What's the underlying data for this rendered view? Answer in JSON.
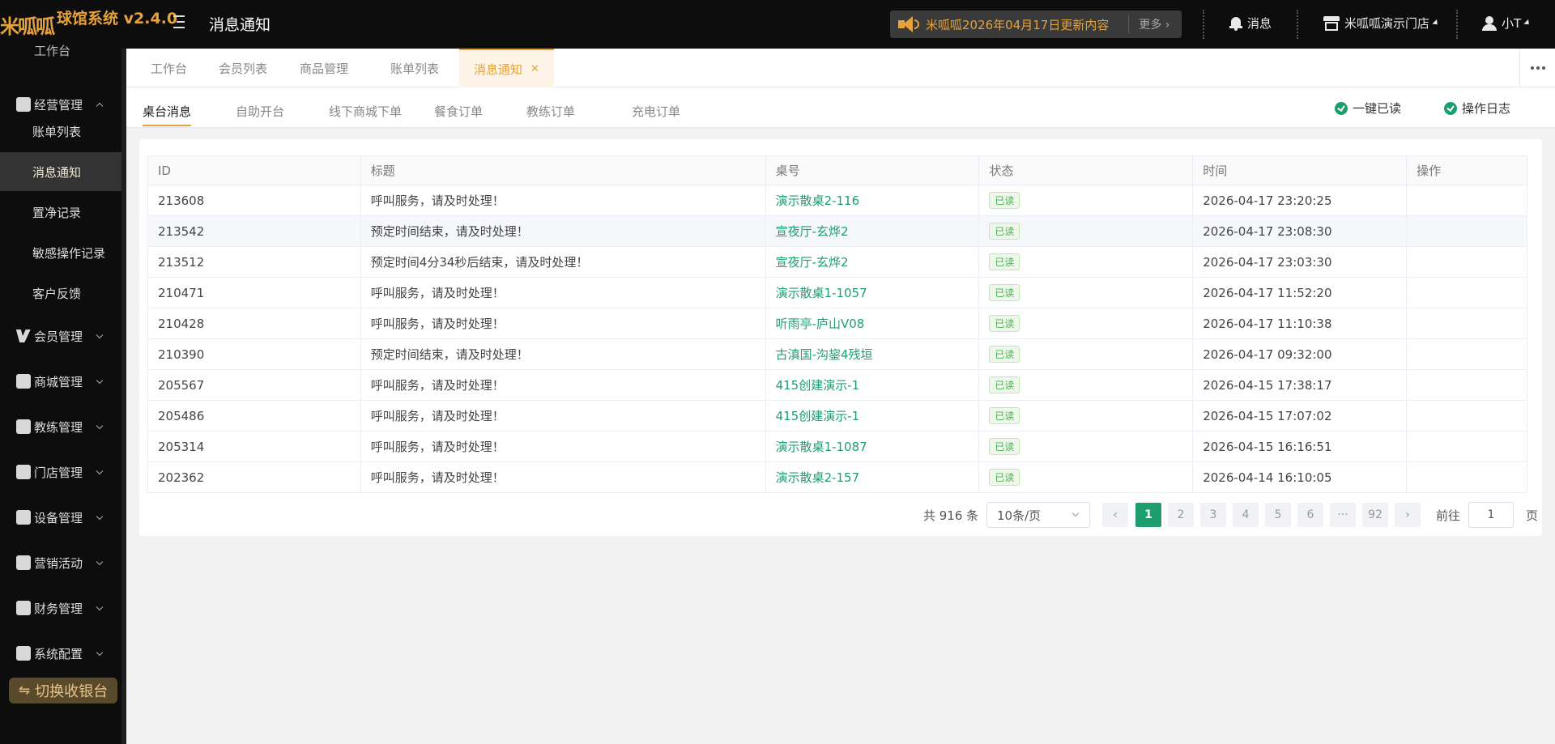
{
  "app": {
    "logo_text": "米呱呱",
    "title": "球馆系统 v2.4.0",
    "page_heading": "消息通知"
  },
  "header": {
    "notice_text": "米呱呱2026年04月17日更新内容",
    "more_label": "更多",
    "messages_label": "消息",
    "store_label": "米呱呱演示门店",
    "user_label": "小T"
  },
  "sidebar": {
    "partial_label": "工作台",
    "groups": [
      {
        "label": "经营管理",
        "icon": "business-icon"
      },
      {
        "label": "会员管理",
        "icon": "member-icon"
      },
      {
        "label": "商城管理",
        "icon": "mall-icon"
      },
      {
        "label": "教练管理",
        "icon": "coach-icon"
      },
      {
        "label": "门店管理",
        "icon": "store-icon"
      },
      {
        "label": "设备管理",
        "icon": "device-icon"
      },
      {
        "label": "营销活动",
        "icon": "star-icon"
      },
      {
        "label": "财务管理",
        "icon": "finance-icon"
      },
      {
        "label": "系统配置",
        "icon": "grid-icon"
      }
    ],
    "sub_items": [
      "账单列表",
      "消息通知",
      "置净记录",
      "敏感操作记录",
      "客户反馈"
    ],
    "switch_label": "切换收银台"
  },
  "tabs": [
    "工作台",
    "会员列表",
    "商品管理",
    "账单列表",
    "消息通知"
  ],
  "subtabs": [
    "桌台消息",
    "自助开台",
    "线下商城下单",
    "餐食订单",
    "教练订单",
    "充电订单"
  ],
  "actions": {
    "mark_all_read": "一键已读",
    "operation_log": "操作日志"
  },
  "table": {
    "columns": [
      "ID",
      "标题",
      "桌号",
      "状态",
      "时间",
      "操作"
    ],
    "rows": [
      {
        "id": "213608",
        "title": "呼叫服务，请及时处理！",
        "table_no": "演示散桌2-116",
        "status": "已读",
        "time": "2026-04-17 23:20:25"
      },
      {
        "id": "213542",
        "title": "预定时间结束，请及时处理！",
        "table_no": "宣夜厅-玄烨2",
        "status": "已读",
        "time": "2026-04-17 23:08:30"
      },
      {
        "id": "213512",
        "title": "预定时间4分34秒后结束，请及时处理！",
        "table_no": "宣夜厅-玄烨2",
        "status": "已读",
        "time": "2026-04-17 23:03:30"
      },
      {
        "id": "210471",
        "title": "呼叫服务，请及时处理！",
        "table_no": "演示散桌1-1057",
        "status": "已读",
        "time": "2026-04-17 11:52:20"
      },
      {
        "id": "210428",
        "title": "呼叫服务，请及时处理！",
        "table_no": "听雨亭-庐山V08",
        "status": "已读",
        "time": "2026-04-17 11:10:38"
      },
      {
        "id": "210390",
        "title": "预定时间结束，请及时处理！",
        "table_no": "古滇国-沟鋆4残垣",
        "status": "已读",
        "time": "2026-04-17 09:32:00"
      },
      {
        "id": "205567",
        "title": "呼叫服务，请及时处理！",
        "table_no": "415创建演示-1",
        "status": "已读",
        "time": "2026-04-15 17:38:17"
      },
      {
        "id": "205486",
        "title": "呼叫服务，请及时处理！",
        "table_no": "415创建演示-1",
        "status": "已读",
        "time": "2026-04-15 17:07:02"
      },
      {
        "id": "205314",
        "title": "呼叫服务，请及时处理！",
        "table_no": "演示散桌1-1087",
        "status": "已读",
        "time": "2026-04-15 16:16:51"
      },
      {
        "id": "202362",
        "title": "呼叫服务，请及时处理！",
        "table_no": "演示散桌2-157",
        "status": "已读",
        "time": "2026-04-14 16:10:05"
      }
    ]
  },
  "pagination": {
    "total_label": "共 916 条",
    "page_size": "10条/页",
    "pages": [
      "1",
      "2",
      "3",
      "4",
      "5",
      "6",
      "···",
      "92"
    ],
    "current_page": "1",
    "goto_prefix": "前往",
    "goto_value": "1",
    "goto_suffix": "页"
  },
  "colors": {
    "accent": "#e6a23c",
    "link_green": "#1e9e6e",
    "topbar_bg": "#0d0d0d"
  }
}
